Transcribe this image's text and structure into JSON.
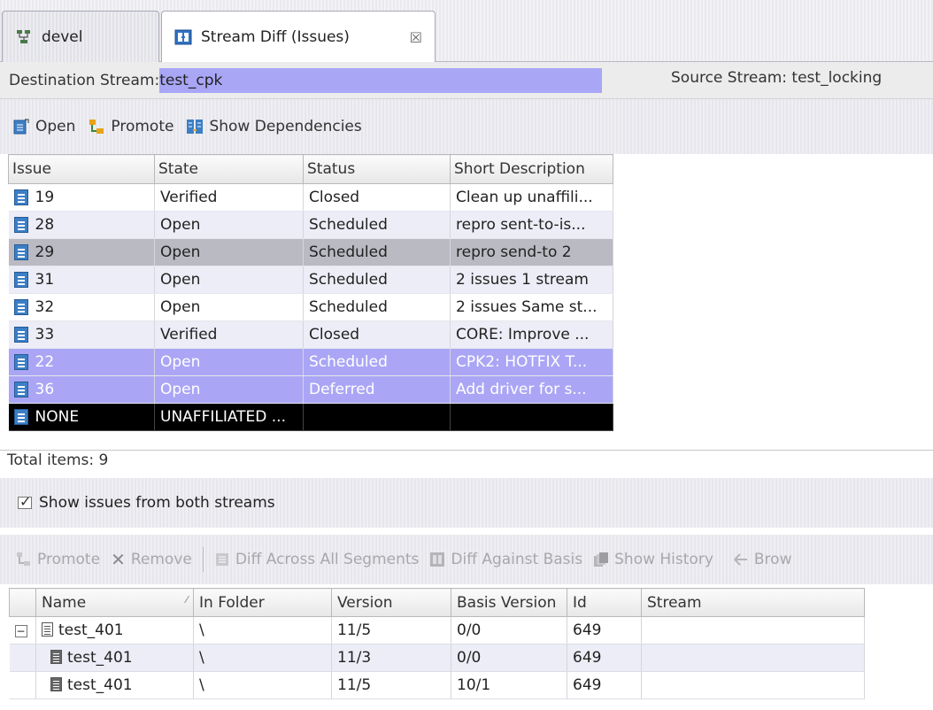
{
  "tabs": [
    {
      "label": "devel",
      "icon": "stream-tree-icon"
    },
    {
      "label": "Stream Diff (Issues)",
      "icon": "stream-diff-icon",
      "close": "☒"
    }
  ],
  "streams": {
    "destination_label": "Destination Stream:",
    "destination_value": "test_cpk",
    "source_label": "Source Stream: test_locking"
  },
  "toolbar": {
    "open": "Open",
    "promote": "Promote",
    "show_dependencies": "Show Dependencies"
  },
  "issues_table": {
    "headers": [
      "Issue",
      "State",
      "Status",
      "Short Description"
    ],
    "rows": [
      {
        "issue": "19",
        "state": "Verified",
        "status": "Closed",
        "desc": "Clean up unaffili..."
      },
      {
        "issue": "28",
        "state": "Open",
        "status": "Scheduled",
        "desc": "repro sent-to-is..."
      },
      {
        "issue": "29",
        "state": "Open",
        "status": "Scheduled",
        "desc": "repro send-to 2"
      },
      {
        "issue": "31",
        "state": "Open",
        "status": "Scheduled",
        "desc": "2 issues 1 stream"
      },
      {
        "issue": "32",
        "state": "Open",
        "status": "Scheduled",
        "desc": "2 issues Same st..."
      },
      {
        "issue": "33",
        "state": "Verified",
        "status": "Closed",
        "desc": "CORE: Improve ..."
      },
      {
        "issue": "22",
        "state": "Open",
        "status": "Scheduled",
        "desc": "CPK2: HOTFIX T..."
      },
      {
        "issue": "36",
        "state": "Open",
        "status": "Deferred",
        "desc": "Add driver for s..."
      },
      {
        "issue": "NONE",
        "state": "UNAFFILIATED ...",
        "status": "",
        "desc": ""
      }
    ]
  },
  "total_items": "Total items: 9",
  "show_both": {
    "label": "Show issues from both streams",
    "checked": true
  },
  "file_toolbar": {
    "promote": "Promote",
    "remove": "Remove",
    "diff_across": "Diff Across All Segments",
    "diff_basis": "Diff Against Basis",
    "show_history": "Show History",
    "browse": "Brow"
  },
  "files_table": {
    "headers": [
      "Name",
      "In Folder",
      "Version",
      "Basis Version",
      "Id",
      "Stream"
    ],
    "rows": [
      {
        "name": "test_401",
        "folder": "\\",
        "version": "11/5",
        "basis": "0/0",
        "id": "649",
        "stream": ""
      },
      {
        "name": "test_401",
        "folder": "\\",
        "version": "11/3",
        "basis": "0/0",
        "id": "649",
        "stream": ""
      },
      {
        "name": "test_401",
        "folder": "\\",
        "version": "11/5",
        "basis": "10/1",
        "id": "649",
        "stream": ""
      }
    ]
  },
  "colors": {
    "selection": "#aaa6f5",
    "grey_row": "#b9bac2",
    "alt_row": "#ededf7",
    "black_row": "#000000"
  }
}
